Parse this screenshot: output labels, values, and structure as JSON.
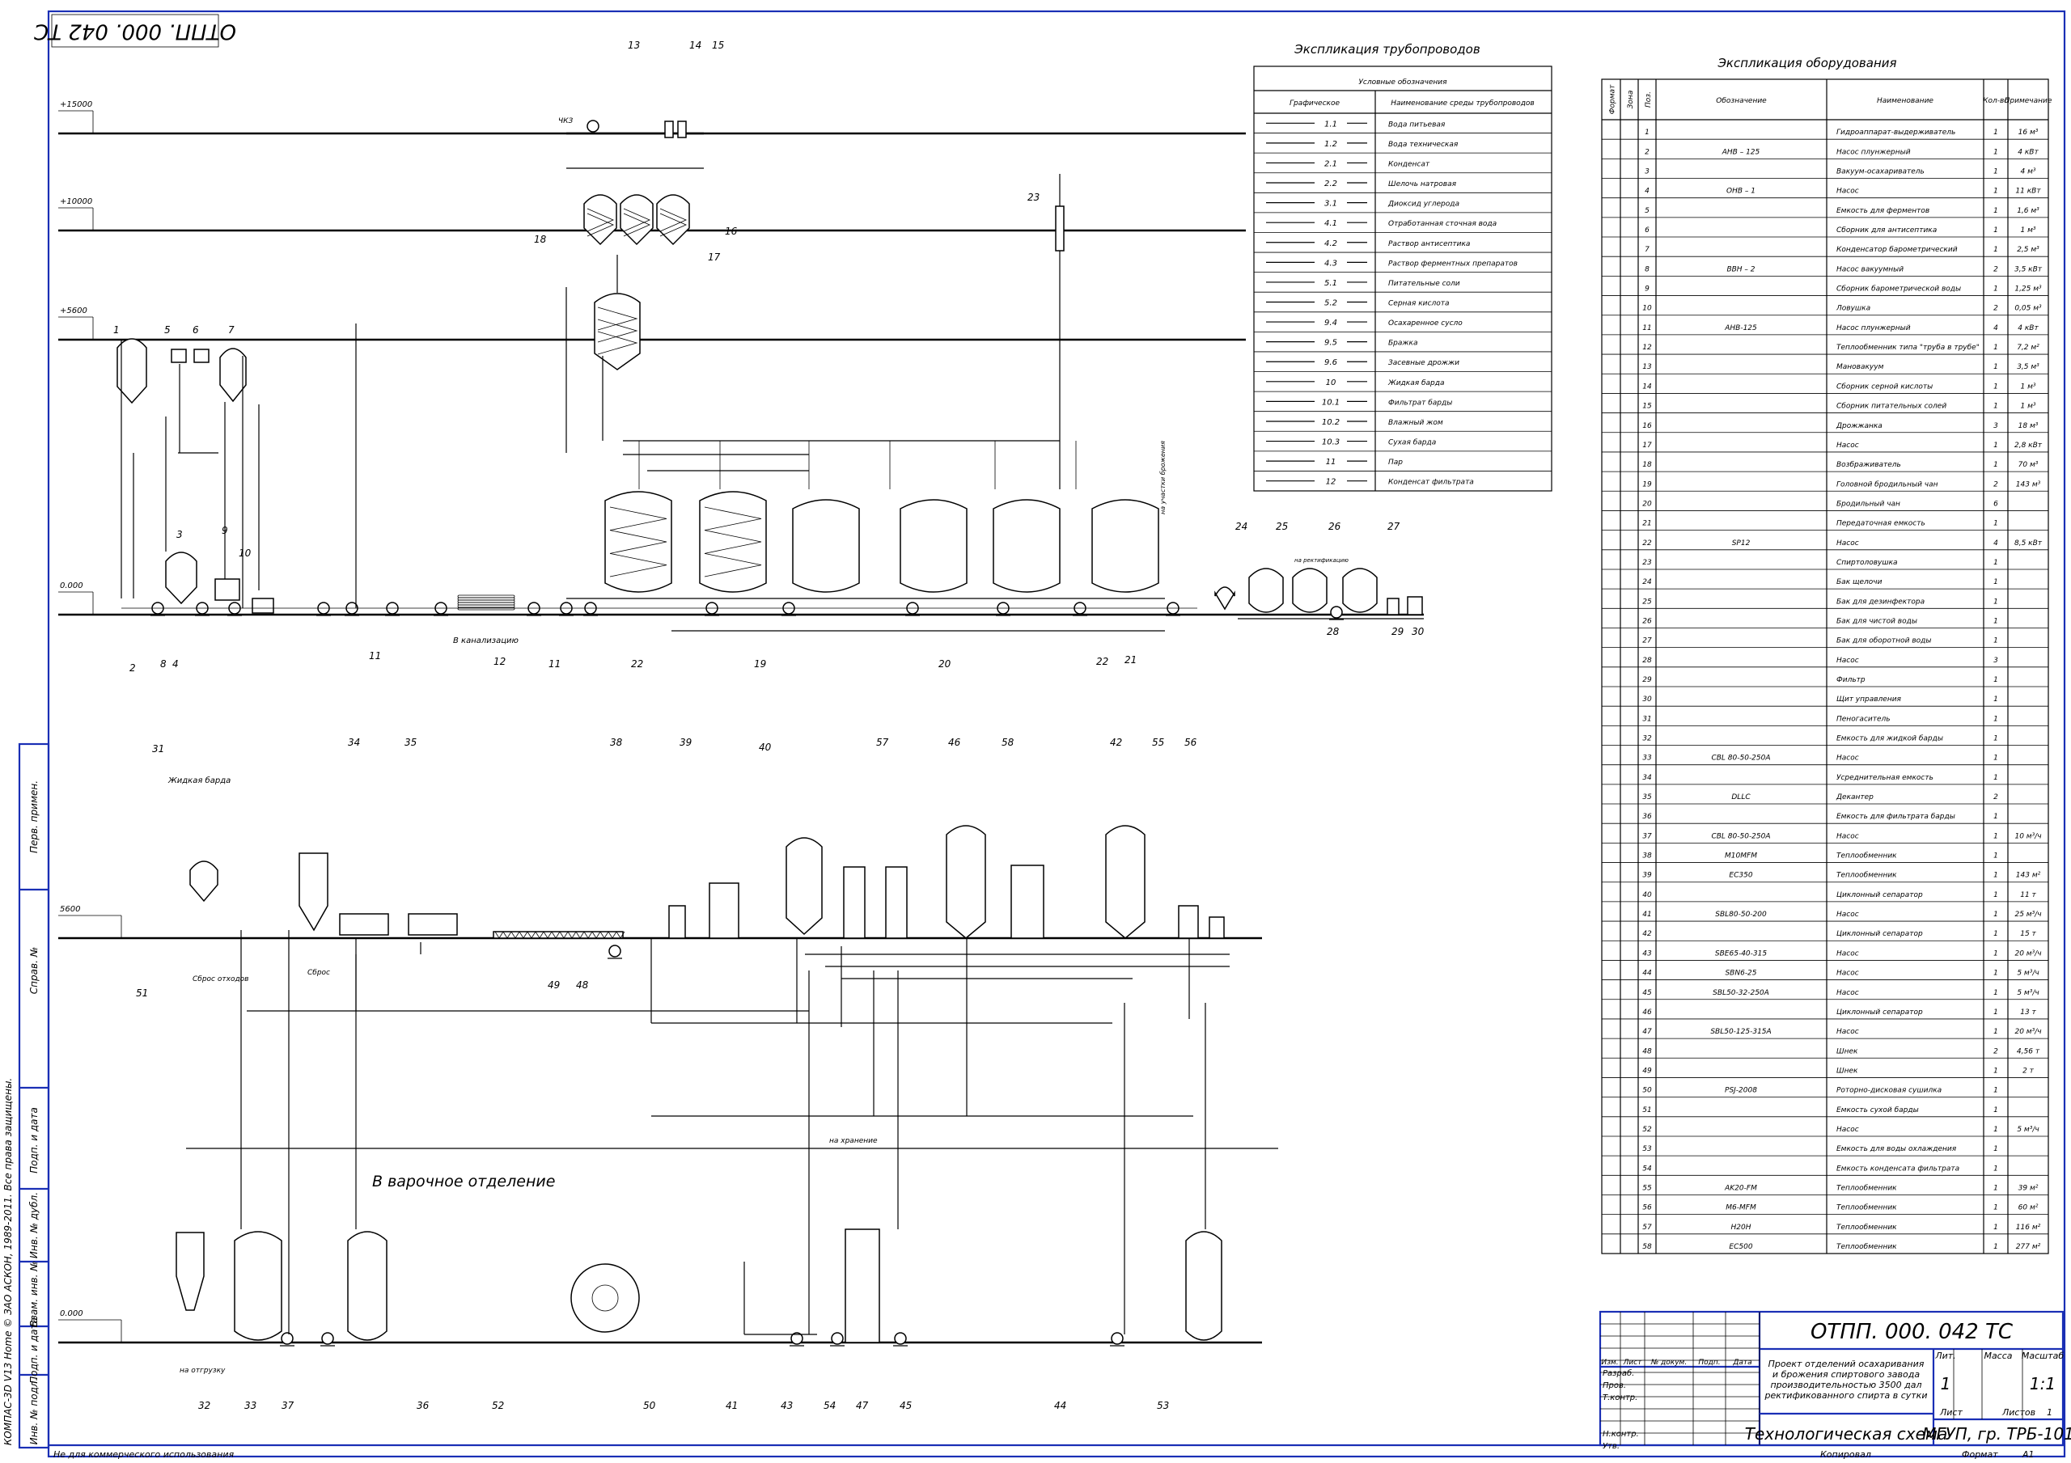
{
  "stamp_code": "ОТПП. 000. 042 ТС",
  "levels": {
    "top": [
      "+15000",
      "+10000",
      "+5600",
      "0.000"
    ],
    "bottom": [
      "5600",
      "0.000"
    ]
  },
  "pipelines": {
    "title": "Экспликация трубопроводов",
    "header_group": "Условные обозначения",
    "col_graphic": "Графическое",
    "col_name": "Наименование среды трубопроводов",
    "rows": [
      {
        "code": "1.1",
        "name": "Вода питьевая"
      },
      {
        "code": "1.2",
        "name": "Вода техническая"
      },
      {
        "code": "2.1",
        "name": "Конденсат"
      },
      {
        "code": "2.2",
        "name": "Шелочь натровая"
      },
      {
        "code": "3.1",
        "name": "Диоксид углерода"
      },
      {
        "code": "4.1",
        "name": "Отработанная сточная вода"
      },
      {
        "code": "4.2",
        "name": "Раствор антисептика"
      },
      {
        "code": "4.3",
        "name": "Раствор ферментных препаратов"
      },
      {
        "code": "5.1",
        "name": "Питательные соли"
      },
      {
        "code": "5.2",
        "name": "Серная кислота"
      },
      {
        "code": "9.4",
        "name": "Осахаренное сусло"
      },
      {
        "code": "9.5",
        "name": "Бражка"
      },
      {
        "code": "9.6",
        "name": "Засевные дрожжи"
      },
      {
        "code": "10",
        "name": "Жидкая барда"
      },
      {
        "code": "10.1",
        "name": "Фильтрат барды"
      },
      {
        "code": "10.2",
        "name": "Влажный жом"
      },
      {
        "code": "10.3",
        "name": "Сухая барда"
      },
      {
        "code": "11",
        "name": "Пар"
      },
      {
        "code": "12",
        "name": "Конденсат фильтрата"
      }
    ]
  },
  "equipment": {
    "title": "Экспликация оборудования",
    "headers": [
      "Формат",
      "Зона",
      "Поз.",
      "Обозначение",
      "Наименование",
      "Кол-во",
      "Примечание"
    ],
    "rows": [
      {
        "pos": "1",
        "des": "",
        "name": "Гидроаппарат-выдерживатель",
        "qty": "1",
        "note": "16 м³"
      },
      {
        "pos": "2",
        "des": "АНВ – 125",
        "name": "Насос плунжерный",
        "qty": "1",
        "note": "4 кВт"
      },
      {
        "pos": "3",
        "des": "",
        "name": "Вакуум-осахариватель",
        "qty": "1",
        "note": "4 м³"
      },
      {
        "pos": "4",
        "des": "ОНВ – 1",
        "name": "Насос",
        "qty": "1",
        "note": "11 кВт"
      },
      {
        "pos": "5",
        "des": "",
        "name": "Емкость для ферментов",
        "qty": "1",
        "note": "1,6 м³"
      },
      {
        "pos": "6",
        "des": "",
        "name": "Сборник для антисептика",
        "qty": "1",
        "note": "1 м³"
      },
      {
        "pos": "7",
        "des": "",
        "name": "Конденсатор барометрический",
        "qty": "1",
        "note": "2,5 м³"
      },
      {
        "pos": "8",
        "des": "ВВН – 2",
        "name": "Насос вакуумный",
        "qty": "2",
        "note": "3,5 кВт"
      },
      {
        "pos": "9",
        "des": "",
        "name": "Сборник барометрической воды",
        "qty": "1",
        "note": "1,25 м³"
      },
      {
        "pos": "10",
        "des": "",
        "name": "Ловушка",
        "qty": "2",
        "note": "0,05 м³"
      },
      {
        "pos": "11",
        "des": "АНВ-125",
        "name": "Насос плунжерный",
        "qty": "4",
        "note": "4 кВт"
      },
      {
        "pos": "12",
        "des": "",
        "name": "Теплообменник типа \"труба в трубе\"",
        "qty": "1",
        "note": "7,2 м²"
      },
      {
        "pos": "13",
        "des": "",
        "name": "Мановакуум",
        "qty": "1",
        "note": "3,5 м³"
      },
      {
        "pos": "14",
        "des": "",
        "name": "Сборник серной кислоты",
        "qty": "1",
        "note": "1 м³"
      },
      {
        "pos": "15",
        "des": "",
        "name": "Сборник питательных солей",
        "qty": "1",
        "note": "1 м³"
      },
      {
        "pos": "16",
        "des": "",
        "name": "Дрожжанка",
        "qty": "3",
        "note": "18 м³"
      },
      {
        "pos": "17",
        "des": "",
        "name": "Насос",
        "qty": "1",
        "note": "2,8 кВт"
      },
      {
        "pos": "18",
        "des": "",
        "name": "Возбраживатель",
        "qty": "1",
        "note": "70 м³"
      },
      {
        "pos": "19",
        "des": "",
        "name": "Головной бродильный чан",
        "qty": "2",
        "note": "143 м³"
      },
      {
        "pos": "20",
        "des": "",
        "name": "Бродильный чан",
        "qty": "6",
        "note": ""
      },
      {
        "pos": "21",
        "des": "",
        "name": "Передаточная емкость",
        "qty": "1",
        "note": ""
      },
      {
        "pos": "22",
        "des": "SP12",
        "name": "Насос",
        "qty": "4",
        "note": "8,5 кВт"
      },
      {
        "pos": "23",
        "des": "",
        "name": "Спиртоловушка",
        "qty": "1",
        "note": ""
      },
      {
        "pos": "24",
        "des": "",
        "name": "Бак щелочи",
        "qty": "1",
        "note": ""
      },
      {
        "pos": "25",
        "des": "",
        "name": "Бак для дезинфектора",
        "qty": "1",
        "note": ""
      },
      {
        "pos": "26",
        "des": "",
        "name": "Бак для чистой воды",
        "qty": "1",
        "note": ""
      },
      {
        "pos": "27",
        "des": "",
        "name": "Бак для оборотной воды",
        "qty": "1",
        "note": ""
      },
      {
        "pos": "28",
        "des": "",
        "name": "Насос",
        "qty": "3",
        "note": ""
      },
      {
        "pos": "29",
        "des": "",
        "name": "Фильтр",
        "qty": "1",
        "note": ""
      },
      {
        "pos": "30",
        "des": "",
        "name": "Щит управления",
        "qty": "1",
        "note": ""
      },
      {
        "pos": "31",
        "des": "",
        "name": "Пеногаситель",
        "qty": "1",
        "note": ""
      },
      {
        "pos": "32",
        "des": "",
        "name": "Емкость для жидкой барды",
        "qty": "1",
        "note": ""
      },
      {
        "pos": "33",
        "des": "CBL 80-50-250A",
        "name": "Насос",
        "qty": "1",
        "note": ""
      },
      {
        "pos": "34",
        "des": "",
        "name": "Усреднительная емкость",
        "qty": "1",
        "note": ""
      },
      {
        "pos": "35",
        "des": "DLLC",
        "name": "Декантер",
        "qty": "2",
        "note": ""
      },
      {
        "pos": "36",
        "des": "",
        "name": "Емкость для фильтрата барды",
        "qty": "1",
        "note": ""
      },
      {
        "pos": "37",
        "des": "CBL 80-50-250A",
        "name": "Насос",
        "qty": "1",
        "note": "10 м³/ч"
      },
      {
        "pos": "38",
        "des": "M10MFM",
        "name": "Теплообменник",
        "qty": "1",
        "note": ""
      },
      {
        "pos": "39",
        "des": "EC350",
        "name": "Теплообменник",
        "qty": "1",
        "note": "143 м²"
      },
      {
        "pos": "40",
        "des": "",
        "name": "Циклонный сепаратор",
        "qty": "1",
        "note": "11 т"
      },
      {
        "pos": "41",
        "des": "SBL80-50-200",
        "name": "Насос",
        "qty": "1",
        "note": "25 м³/ч"
      },
      {
        "pos": "42",
        "des": "",
        "name": "Циклонный сепаратор",
        "qty": "1",
        "note": "15 т"
      },
      {
        "pos": "43",
        "des": "SBE65-40-315",
        "name": "Насос",
        "qty": "1",
        "note": "20 м³/ч"
      },
      {
        "pos": "44",
        "des": "SBN6-25",
        "name": "Насос",
        "qty": "1",
        "note": "5 м³/ч"
      },
      {
        "pos": "45",
        "des": "SBL50-32-250A",
        "name": "Насос",
        "qty": "1",
        "note": "5 м³/ч"
      },
      {
        "pos": "46",
        "des": "",
        "name": "Циклонный сепаратор",
        "qty": "1",
        "note": "13 т"
      },
      {
        "pos": "47",
        "des": "SBL50-125-315A",
        "name": "Насос",
        "qty": "1",
        "note": "20 м³/ч"
      },
      {
        "pos": "48",
        "des": "",
        "name": "Шнек",
        "qty": "2",
        "note": "4,56 т"
      },
      {
        "pos": "49",
        "des": "",
        "name": "Шнек",
        "qty": "1",
        "note": "2 т"
      },
      {
        "pos": "50",
        "des": "PSJ-2008",
        "name": "Роторно-дисковая сушилка",
        "qty": "1",
        "note": ""
      },
      {
        "pos": "51",
        "des": "",
        "name": "Емкость сухой барды",
        "qty": "1",
        "note": ""
      },
      {
        "pos": "52",
        "des": "",
        "name": "Насос",
        "qty": "1",
        "note": "5 м³/ч"
      },
      {
        "pos": "53",
        "des": "",
        "name": "Емкость для воды охлаждения",
        "qty": "1",
        "note": ""
      },
      {
        "pos": "54",
        "des": "",
        "name": "Емкость конденсата фильтрата",
        "qty": "1",
        "note": ""
      },
      {
        "pos": "55",
        "des": "AK20-FM",
        "name": "Теплообменник",
        "qty": "1",
        "note": "39 м²"
      },
      {
        "pos": "56",
        "des": "M6-MFM",
        "name": "Теплообменник",
        "qty": "1",
        "note": "60 м²"
      },
      {
        "pos": "57",
        "des": "Н20Н",
        "name": "Теплообменник",
        "qty": "1",
        "note": "116 м²"
      },
      {
        "pos": "58",
        "des": "EC500",
        "name": "Теплообменник",
        "qty": "1",
        "note": "277 м²"
      }
    ]
  },
  "title_block": {
    "code": "ОТПП. 000. 042 ТС",
    "description": "Проект отделений осахаривания и брожения спиртового завода производительностью 3500 дал ректификованного спирта в сутки",
    "doc_name": "Технологическая схема",
    "org": "МГУП, гр. ТРБ-101",
    "col_lit": "Лит.",
    "col_mass": "Масса",
    "col_scale": "Масштаб",
    "lit_value": "1",
    "scale_value": "1:1",
    "sheet_label": "Лист",
    "sheets_label": "Листов",
    "sheets_value": "1",
    "change_cols": [
      "Изм.",
      "Лист",
      "№ докум.",
      "Подп.",
      "Дата"
    ],
    "roles": [
      "Разраб.",
      "Пров.",
      "Т.контр.",
      "",
      "Н.контр.",
      "Утв."
    ]
  },
  "footer": {
    "copy": "Копировал",
    "format_label": "Формат",
    "format_value": "А1",
    "noncommercial": "Не для коммерческого использования"
  },
  "left_strip": {
    "software": "КОМПАС-3D V13 Home © ЗАО АСКОН, 1989-2011. Все права защищены.",
    "perv": "Перв. примен.",
    "sprav": "Справ. №",
    "podp_data": "Подп. и дата",
    "inv_dubl": "Инв. № дубл.",
    "vzam": "Взам. инв. №",
    "inv_podl": "Инв. № подл."
  },
  "annotations": {
    "to_sewer": "В канализацию",
    "to_distill": "на ректификацию",
    "liquid_vinasse": "Жидкая барда",
    "discharge": "Сброс отходов",
    "exhaust": "Сброс",
    "to_cooking": "В варочное отделение",
    "to_storage": "на хранение",
    "to_shipping": "на отгрузку",
    "cks": "ЧКЗ",
    "to_fermenters": "на участки брожения"
  },
  "callouts_top": [
    "13",
    "14",
    "15",
    "16",
    "17",
    "18",
    "23",
    "1",
    "5",
    "6",
    "7",
    "3",
    "10",
    "9",
    "2",
    "8",
    "4",
    "11",
    "12",
    "11",
    "22",
    "19",
    "20",
    "21",
    "22",
    "24",
    "25",
    "26",
    "27",
    "28",
    "29",
    "30"
  ],
  "callouts_bottom": [
    "31",
    "34",
    "35",
    "38",
    "39",
    "40",
    "57",
    "46",
    "58",
    "42",
    "55",
    "56",
    "51",
    "49",
    "48",
    "32",
    "33",
    "37",
    "36",
    "52",
    "50",
    "41",
    "43",
    "54",
    "47",
    "45",
    "44",
    "53"
  ]
}
